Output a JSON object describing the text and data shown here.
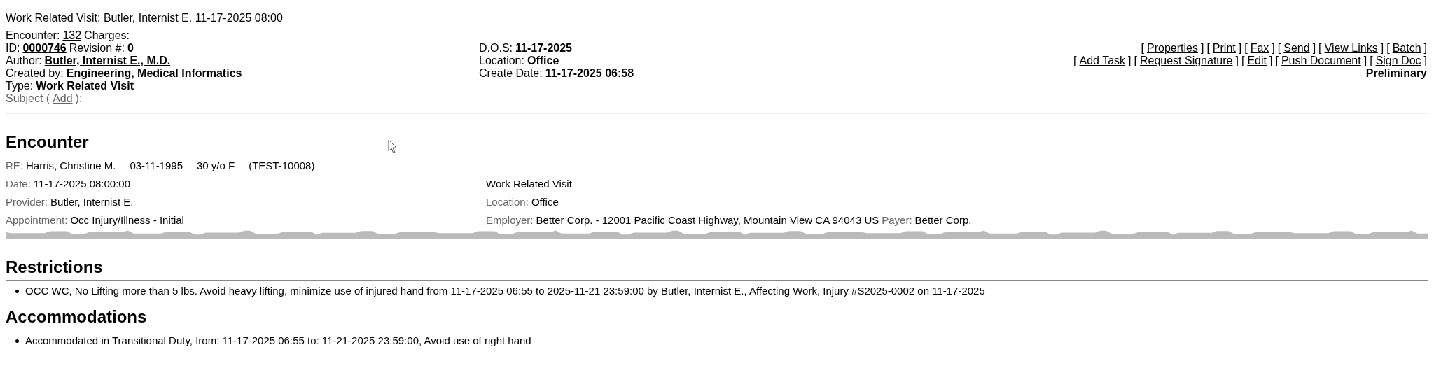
{
  "title": "Work Related Visit: Butler, Internist E. 11-17-2025 08:00",
  "header_left": [
    [
      {
        "kind": "plain",
        "text": "Encounter:"
      },
      {
        "kind": "link",
        "text": "132"
      },
      {
        "kind": "plain",
        "text": "Charges:"
      }
    ],
    [
      {
        "kind": "plain",
        "text": "ID:"
      },
      {
        "kind": "strong_link",
        "text": "0000746"
      },
      {
        "kind": "plain",
        "text": "Revision #:"
      },
      {
        "kind": "strong",
        "text": "0"
      }
    ],
    [
      {
        "kind": "plain",
        "text": "Author:"
      },
      {
        "kind": "strong_link",
        "text": "Butler, Internist E., M.D."
      }
    ],
    [
      {
        "kind": "plain",
        "text": "Created by:"
      },
      {
        "kind": "strong_link",
        "text": "Engineering, Medical Informatics"
      }
    ],
    [
      {
        "kind": "plain",
        "text": "Type:"
      },
      {
        "kind": "strong",
        "text": "Work Related Visit"
      }
    ],
    [
      {
        "kind": "muted",
        "text": "Subject ("
      },
      {
        "kind": "muted_link",
        "text": "Add"
      },
      {
        "kind": "muted",
        "text": "):"
      }
    ]
  ],
  "header_middle": [
    [
      {
        "kind": "plain",
        "text": "D.O.S:"
      },
      {
        "kind": "strong",
        "text": "11-17-2025"
      }
    ],
    [
      {
        "kind": "plain",
        "text": "Location:"
      },
      {
        "kind": "strong",
        "text": "Office"
      }
    ],
    [
      {
        "kind": "plain",
        "text": "Create Date:"
      },
      {
        "kind": "strong",
        "text": "11-17-2025 06:58"
      }
    ]
  ],
  "actions": [
    [
      {
        "before": "[",
        "label": "Properties",
        "after": "]"
      },
      {
        "before": "[",
        "label": "Print",
        "after": "]"
      },
      {
        "before": "[",
        "label": "Fax",
        "after": "]"
      },
      {
        "before": "[",
        "label": "Send",
        "after": "]"
      },
      {
        "before": "[",
        "label": "View Links",
        "after": "]"
      },
      {
        "before": "[",
        "label": "Batch",
        "after": "]"
      }
    ],
    [
      {
        "before": "[",
        "label": "Add Task",
        "after": "]"
      },
      {
        "before": "[",
        "label": "Request Signature",
        "after": "]"
      },
      {
        "before": "[",
        "label": "Edit",
        "after": "]"
      },
      {
        "before": "[",
        "label": "Push Document",
        "after": "]"
      },
      {
        "before": "[",
        "label": "Sign Doc",
        "after": "]"
      }
    ]
  ],
  "status": "Preliminary",
  "encounter": {
    "heading": "Encounter",
    "patient": {
      "label": "RE:",
      "values": [
        "Harris, Christine M.",
        "03-11-1995",
        "30 y/o F",
        "(TEST-10008)"
      ]
    },
    "rows": [
      {
        "left": [
          {
            "label": "Date:",
            "value": "11-17-2025 08:00:00"
          }
        ],
        "right": [
          {
            "value": "Work Related Visit"
          }
        ]
      },
      {
        "left": [
          {
            "label": "Provider:",
            "value": "Butler, Internist E."
          }
        ],
        "right": [
          {
            "label": "Location:",
            "value": "Office"
          }
        ]
      },
      {
        "left": [
          {
            "label": "Appointment:",
            "value": "Occ Injury/Illness - Initial"
          }
        ],
        "right": [
          {
            "label": "Employer:",
            "value": "Better Corp. - 12001 Pacific Coast Highway, Mountain View CA 94043 US"
          },
          {
            "label": "Payer:",
            "value": "Better Corp."
          }
        ]
      }
    ]
  },
  "sections": [
    {
      "heading": "Restrictions",
      "items": [
        "OCC WC, No Lifting more than 5 lbs. Avoid heavy lifting, minimize use of injured hand from 11-17-2025 06:55 to 2025-11-21 23:59:00 by Butler, Internist E., Affecting Work, Injury #S2025-0002 on 11-17-2025"
      ]
    },
    {
      "heading": "Accommodations",
      "items": [
        "Accommodated in Transitional Duty, from: 11-17-2025 06:55 to: 11-21-2025 23:59:00, Avoid use of right hand"
      ]
    }
  ]
}
